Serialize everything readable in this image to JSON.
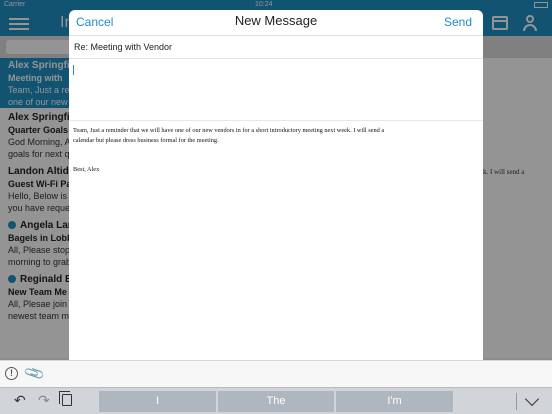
{
  "status_bar": {
    "carrier": "Carrier",
    "time": "10:24"
  },
  "app": {
    "title": "In"
  },
  "inbox": {
    "items": [
      {
        "sender": "Alex Springfi",
        "subject": "Meeting with",
        "preview": "Team, Just a remin",
        "preview2": "one of our new ",
        "selected": true,
        "unread": false
      },
      {
        "sender": "Alex Springfi",
        "subject": "Quarter Goals",
        "preview": "God Morning, A",
        "preview2": "goals for next q",
        "selected": false,
        "unread": false
      },
      {
        "sender": "Landon Altide",
        "subject": "Guest Wi-Fi Pa",
        "preview": "Hello, Below is",
        "preview2": "you have reque",
        "selected": false,
        "unread": false
      },
      {
        "sender": "Angela Lar",
        "subject": "Bagels in Lobb",
        "preview": "All, Please stop",
        "preview2": "morning to grab",
        "selected": false,
        "unread": true
      },
      {
        "sender": "Reginald B",
        "subject": "New Team Me",
        "preview": "All, Plesae join",
        "preview2": "newest team me",
        "selected": false,
        "unread": true
      }
    ]
  },
  "background_right_text": "k. I will send a",
  "compose": {
    "cancel_label": "Cancel",
    "title": "New Message",
    "send_label": "Send",
    "subject": "Re: Meeting with Vendor",
    "body_value": "",
    "quoted_line1": "Team, Just a reminder that we will have one of our new vendors in for a short introductory meeting next week. I will send a",
    "quoted_line2": "calendar but please dress business formal for the meeting.",
    "signature": "Best, Alex"
  },
  "toolbar": {
    "importance_icon": "!",
    "attach_icon": "paperclip-icon"
  },
  "keyboard": {
    "suggestions": [
      "I",
      "The",
      "I'm"
    ],
    "undo_icon": "undo-icon",
    "redo_icon": "redo-icon",
    "paste_icon": "paste-icon",
    "dismiss_icon": "keyboard-dismiss-icon"
  },
  "colors": {
    "accent": "#1f8fc4",
    "dim_overlay": "rgba(0,0,0,0.42)"
  }
}
